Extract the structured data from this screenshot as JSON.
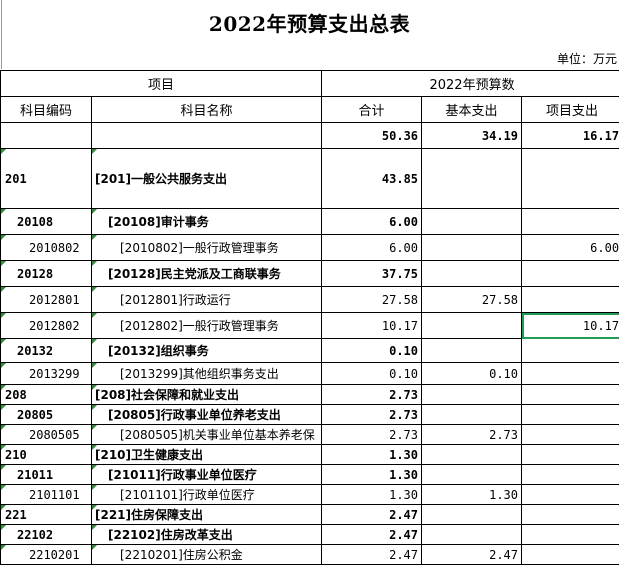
{
  "title": "2022年预算支出总表",
  "unit": "单位：万元",
  "header": {
    "project": "项目",
    "budget_group": "2022年预算数",
    "code": "科目编码",
    "name": "科目名称",
    "total": "合计",
    "basic": "基本支出",
    "proj": "项目支出"
  },
  "rows": [
    {
      "level": 0,
      "code": "",
      "name": "",
      "total": "50.36",
      "basic": "34.19",
      "proj": "16.17"
    },
    {
      "level": 1,
      "code": "201",
      "name": "[201]一般公共服务支出",
      "total": "43.85",
      "basic": "",
      "proj": ""
    },
    {
      "level": 2,
      "code": "20108",
      "name": "[20108]审计事务",
      "total": "6.00",
      "basic": "",
      "proj": ""
    },
    {
      "level": 3,
      "code": "2010802",
      "name": "[2010802]一般行政管理事务",
      "total": "6.00",
      "basic": "",
      "proj": "6.00"
    },
    {
      "level": 2,
      "code": "20128",
      "name": "[20128]民主党派及工商联事务",
      "total": "37.75",
      "basic": "",
      "proj": ""
    },
    {
      "level": 3,
      "code": "2012801",
      "name": "[2012801]行政运行",
      "total": "27.58",
      "basic": "27.58",
      "proj": ""
    },
    {
      "level": 3,
      "code": "2012802",
      "name": "[2012802]一般行政管理事务",
      "total": "10.17",
      "basic": "",
      "proj": "10.17"
    },
    {
      "level": 2,
      "code": "20132",
      "name": "[20132]组织事务",
      "total": "0.10",
      "basic": "",
      "proj": ""
    },
    {
      "level": 3,
      "code": "2013299",
      "name": "[2013299]其他组织事务支出",
      "total": "0.10",
      "basic": "0.10",
      "proj": ""
    },
    {
      "level": 1,
      "code": "208",
      "name": "[208]社会保障和就业支出",
      "total": "2.73",
      "basic": "",
      "proj": ""
    },
    {
      "level": 2,
      "code": "20805",
      "name": "[20805]行政事业单位养老支出",
      "total": "2.73",
      "basic": "",
      "proj": ""
    },
    {
      "level": 3,
      "code": "2080505",
      "name": "[2080505]机关事业单位基本养老保",
      "total": "2.73",
      "basic": "2.73",
      "proj": ""
    },
    {
      "level": 1,
      "code": "210",
      "name": "[210]卫生健康支出",
      "total": "1.30",
      "basic": "",
      "proj": ""
    },
    {
      "level": 2,
      "code": "21011",
      "name": "[21011]行政事业单位医疗",
      "total": "1.30",
      "basic": "",
      "proj": ""
    },
    {
      "level": 3,
      "code": "2101101",
      "name": "[2101101]行政单位医疗",
      "total": "1.30",
      "basic": "1.30",
      "proj": ""
    },
    {
      "level": 1,
      "code": "221",
      "name": "[221]住房保障支出",
      "total": "2.47",
      "basic": "",
      "proj": ""
    },
    {
      "level": 2,
      "code": "22102",
      "name": "[22102]住房改革支出",
      "total": "2.47",
      "basic": "",
      "proj": ""
    },
    {
      "level": 3,
      "code": "2210201",
      "name": "[2210201]住房公积金",
      "total": "2.47",
      "basic": "2.47",
      "proj": ""
    }
  ]
}
